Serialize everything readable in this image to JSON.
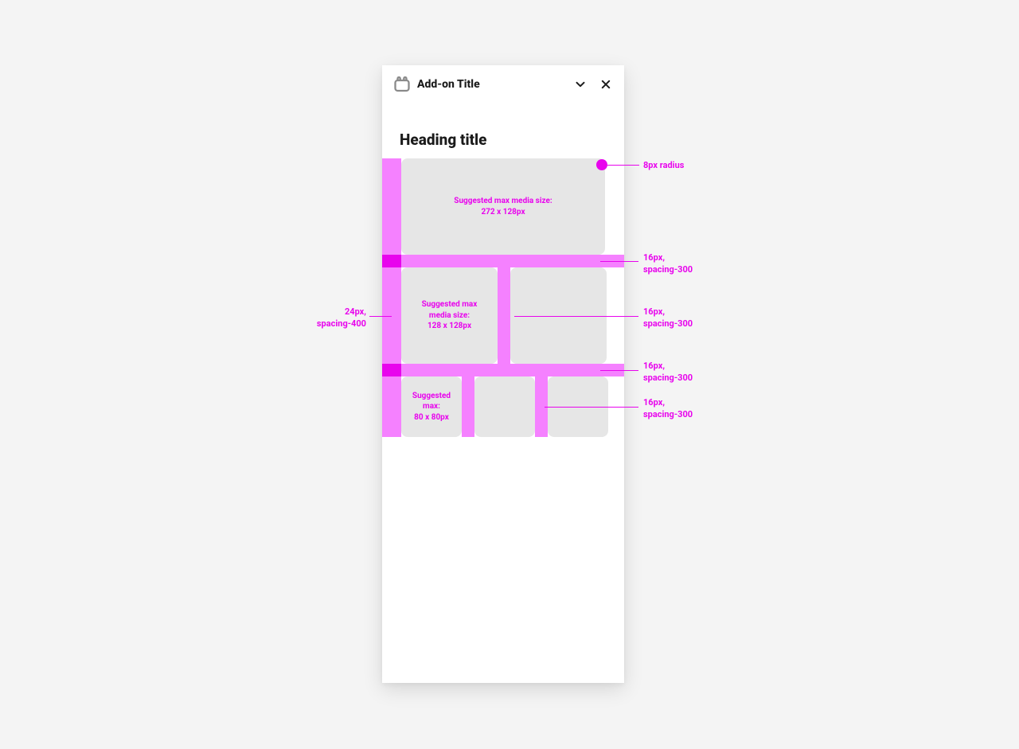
{
  "panel": {
    "addon_title": "Add-on Title",
    "heading": "Heading title"
  },
  "cards": {
    "full": {
      "line1": "Suggested max media size:",
      "line2": "272 x 128px"
    },
    "half": {
      "line1": "Suggested max",
      "line2": "media size:",
      "line3": "128 x 128px"
    },
    "third": {
      "line1": "Suggested",
      "line2": "max:",
      "line3": "80 x 80px"
    }
  },
  "annotations": {
    "radius": "8px radius",
    "row_gap_1": "16px,\nspacing-300",
    "col_gap_mid": "16px,\nspacing-300",
    "row_gap_2": "16px,\nspacing-300",
    "col_gap_sm": "16px,\nspacing-300",
    "outer_margin": "24px,\nspacing-400"
  }
}
